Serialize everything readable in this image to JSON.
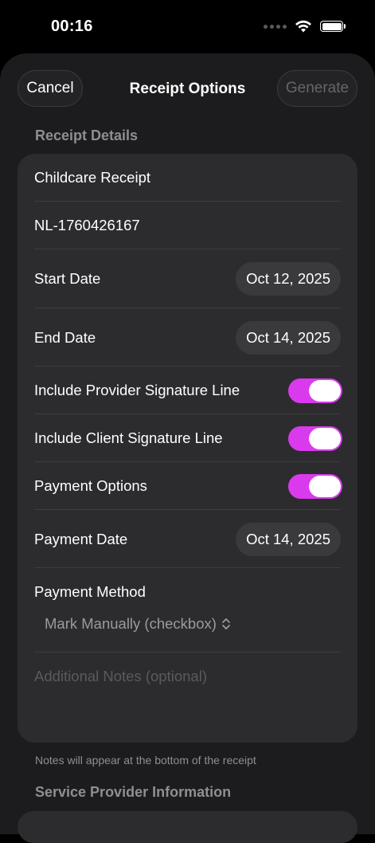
{
  "status": {
    "time": "00:16"
  },
  "nav": {
    "cancel": "Cancel",
    "title": "Receipt Options",
    "generate": "Generate"
  },
  "receipt": {
    "section_title": "Receipt Details",
    "title_value": "Childcare Receipt",
    "receipt_number": "NL-1760426167",
    "start_date_label": "Start Date",
    "start_date": "Oct 12, 2025",
    "end_date_label": "End Date",
    "end_date": "Oct 14, 2025",
    "provider_sig_label": "Include Provider Signature Line",
    "provider_sig_on": true,
    "client_sig_label": "Include Client Signature Line",
    "client_sig_on": true,
    "payment_options_label": "Payment Options",
    "payment_options_on": true,
    "payment_date_label": "Payment Date",
    "payment_date": "Oct 14, 2025",
    "payment_method_label": "Payment Method",
    "payment_method_value": "Mark Manually (checkbox)",
    "notes_placeholder": "Additional Notes (optional)",
    "footer_note": "Notes will appear at the bottom of the receipt"
  },
  "provider": {
    "section_title": "Service Provider Information"
  },
  "colors": {
    "accent": "#da3aed",
    "background": "#000000",
    "sheet": "#1c1c1e",
    "card": "#2c2c2e"
  }
}
